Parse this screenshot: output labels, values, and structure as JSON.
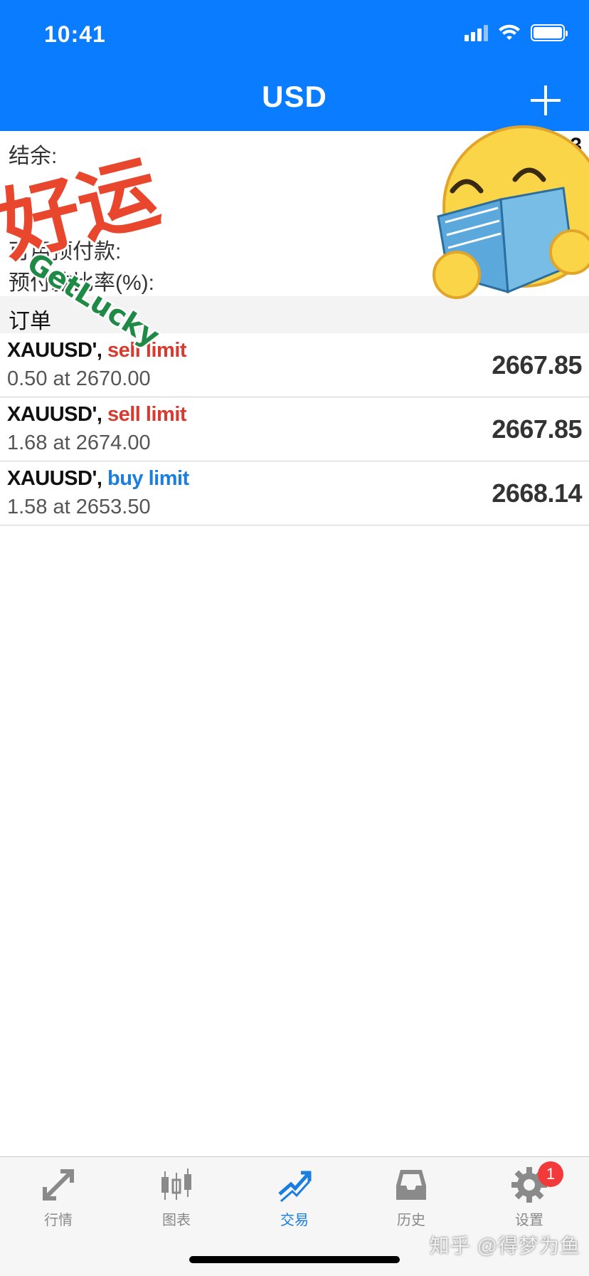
{
  "status": {
    "time": "10:41"
  },
  "nav": {
    "title": "USD"
  },
  "summary": {
    "rows": [
      {
        "label": "结余:",
        "value": ""
      },
      {
        "label": "",
        "value": ""
      },
      {
        "label": "",
        "value": ""
      },
      {
        "label": "可用预付款:",
        "value": ""
      },
      {
        "label": "预付款比率(%):",
        "value": ""
      }
    ],
    "first_value_fragment": "3"
  },
  "section": {
    "orders_title": "订单"
  },
  "orders": [
    {
      "symbol": "XAUUSD',",
      "type": "sell limit",
      "detail": "0.50 at 2670.00",
      "price": "2667.85",
      "side": "sell"
    },
    {
      "symbol": "XAUUSD',",
      "type": "sell limit",
      "detail": "1.68 at 2674.00",
      "price": "2667.85",
      "side": "sell"
    },
    {
      "symbol": "XAUUSD',",
      "type": "buy limit",
      "detail": "1.58 at 2653.50",
      "price": "2668.14",
      "side": "buy"
    }
  ],
  "stickers": {
    "lucky_text": "好运",
    "lucky_sub": "GetLucky"
  },
  "tabs": [
    {
      "label": "行情",
      "icon": "quotes-arrows-icon",
      "active": false
    },
    {
      "label": "图表",
      "icon": "candlestick-chart-icon",
      "active": false
    },
    {
      "label": "交易",
      "icon": "trade-trend-icon",
      "active": true
    },
    {
      "label": "历史",
      "icon": "history-inbox-icon",
      "active": false
    },
    {
      "label": "设置",
      "icon": "settings-gear-icon",
      "active": false,
      "badge": "1"
    }
  ],
  "watermark": "知乎 @得梦为鱼",
  "colors": {
    "primary": "#0a7cff",
    "sell": "#d83a2f",
    "buy": "#1a7ee0"
  }
}
